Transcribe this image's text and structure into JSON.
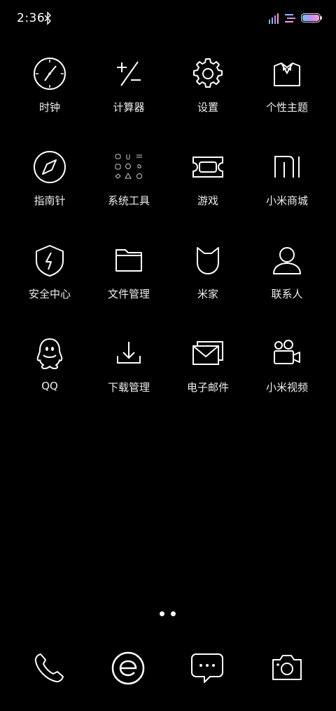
{
  "status_bar": {
    "time": "2:36",
    "icons": [
      "bluetooth-icon",
      "signal-icon",
      "menu-icon",
      "battery-icon"
    ],
    "battery_gradient": [
      "#5ec8ff",
      "#c78bff",
      "#ff9bd0"
    ]
  },
  "apps": [
    {
      "label": "时钟",
      "icon": "clock-icon"
    },
    {
      "label": "计算器",
      "icon": "calculator-icon"
    },
    {
      "label": "设置",
      "icon": "gear-icon"
    },
    {
      "label": "个性主题",
      "icon": "theme-icon"
    },
    {
      "label": "指南针",
      "icon": "compass-icon"
    },
    {
      "label": "系统工具",
      "icon": "tools-folder-icon"
    },
    {
      "label": "游戏",
      "icon": "game-ticket-icon"
    },
    {
      "label": "小米商城",
      "icon": "mi-store-icon"
    },
    {
      "label": "安全中心",
      "icon": "shield-icon"
    },
    {
      "label": "文件管理",
      "icon": "folder-icon"
    },
    {
      "label": "米家",
      "icon": "mijia-icon"
    },
    {
      "label": "联系人",
      "icon": "contacts-icon"
    },
    {
      "label": "QQ",
      "icon": "qq-icon"
    },
    {
      "label": "下载管理",
      "icon": "download-icon"
    },
    {
      "label": "电子邮件",
      "icon": "email-icon"
    },
    {
      "label": "小米视频",
      "icon": "video-icon"
    }
  ],
  "page_indicator": {
    "pages": 2,
    "current": 1
  },
  "dock": [
    {
      "name": "phone",
      "icon": "phone-icon"
    },
    {
      "name": "browser",
      "icon": "browser-icon"
    },
    {
      "name": "messages",
      "icon": "message-icon"
    },
    {
      "name": "camera",
      "icon": "camera-icon"
    }
  ]
}
